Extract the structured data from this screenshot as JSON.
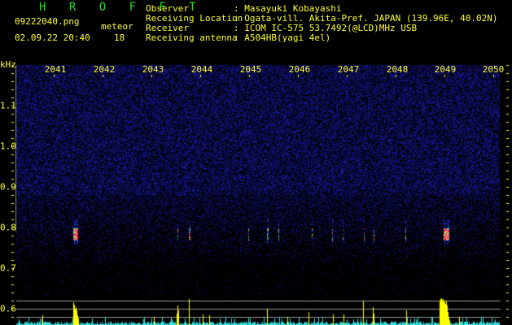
{
  "app_title": "H R O F F T",
  "file_name": "09222040.png",
  "datetime": "02.09.22 20:40",
  "meteor_label": "meteor",
  "meteor_count": "18",
  "info": [
    {
      "label": "Observer",
      "value": ": Masayuki Kobayashi"
    },
    {
      "label": "Receiving Location",
      "value": ": Ogata-vill. Akita-Pref. JAPAN (139.96E, 40.02N)"
    },
    {
      "label": "Receiver",
      "value": ": ICOM IC-575 53.7492(@LCD)MHz USB"
    },
    {
      "label": "Receiving antenna",
      "value": ": A504HB(yagi 4el)"
    }
  ],
  "y_unit": "kHz",
  "y_ticks": [
    "1.1",
    "1.0",
    "0.9",
    "0.8",
    "0.7",
    "0.6"
  ],
  "x_ticks": [
    "2041",
    "2042",
    "2043",
    "2044",
    "2045",
    "2046",
    "2047",
    "2048",
    "2049",
    "2050"
  ],
  "colors": {
    "text": "#ffff33",
    "title": "#22dd22",
    "noise": "#1a1aa0",
    "bars": "#ffff00",
    "bars_low": "#33dddd",
    "grid": "#999999"
  }
}
